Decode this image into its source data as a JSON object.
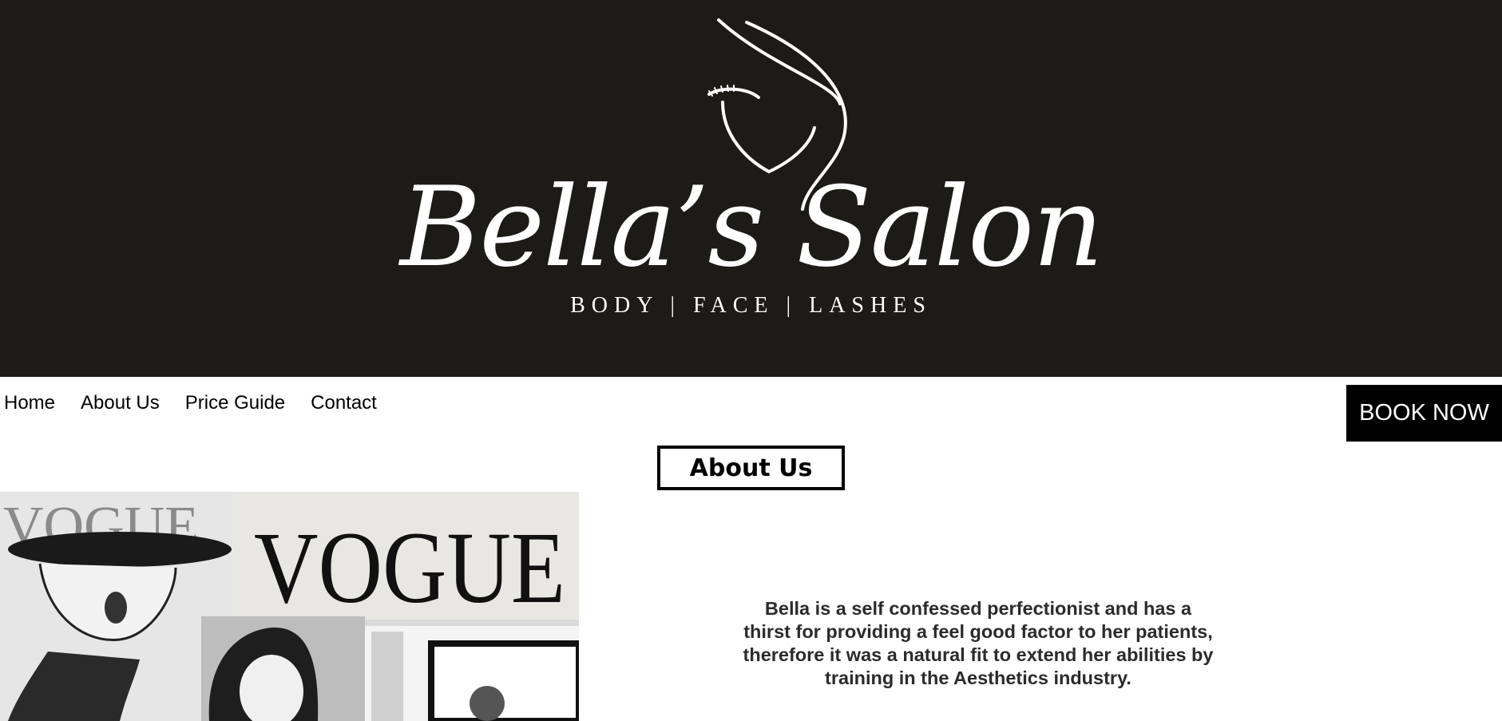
{
  "header": {
    "brand_name": "Bella’s Salon",
    "tagline": "BODY | FACE | LASHES",
    "background_color": "#1d1b18"
  },
  "nav": {
    "items": [
      "Home",
      "About Us",
      "Price Guide",
      "Contact"
    ]
  },
  "book_button": {
    "label": "BOOK NOW"
  },
  "about": {
    "title": "About Us",
    "body": "Bella is a self confessed perfectionist and has a thirst for providing a feel good factor to her patients, therefore it was a natural fit to extend her abilities by training in the Aesthetics industry."
  },
  "collage": {
    "caption_left": "VOGUE",
    "caption_right": "VOGUE"
  }
}
